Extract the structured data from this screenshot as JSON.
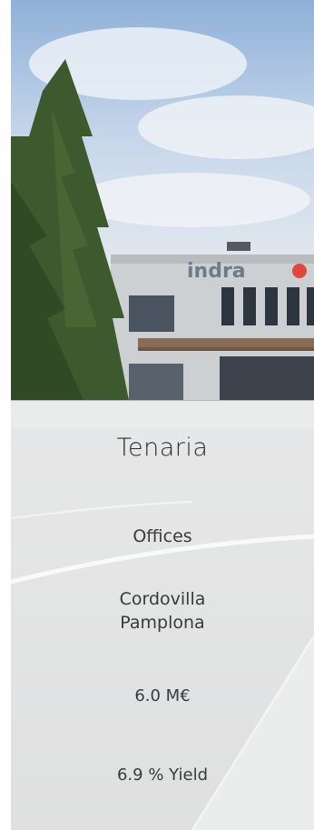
{
  "property": {
    "name": "Tenaria",
    "type": "Offices",
    "location_line1": "Cordovilla",
    "location_line2": "Pamplona",
    "price": "6.0 M€",
    "yield": "6.9 % Yield"
  },
  "photo": {
    "signage": "indra",
    "sky_color": "#b7cde6",
    "road_color": "#9a9c9d",
    "building_color": "#cfd1d3",
    "tree_color": "#3b5a2c"
  }
}
